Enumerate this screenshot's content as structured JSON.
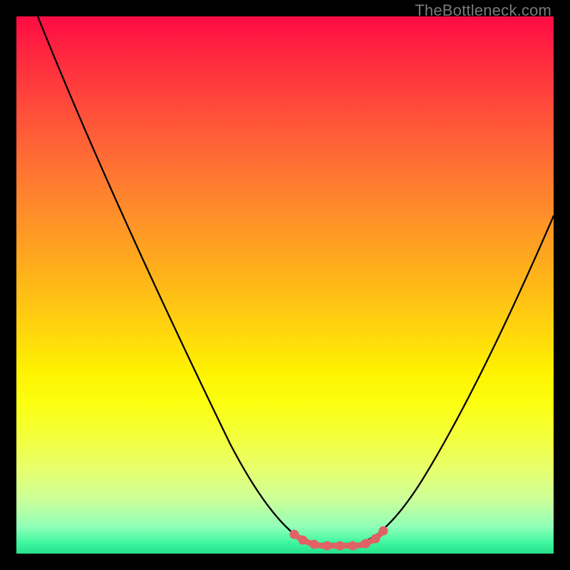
{
  "watermark": "TheBottleneck.com",
  "chart_data": {
    "type": "line",
    "title": "",
    "xlabel": "",
    "ylabel": "",
    "xlim": [
      0,
      100
    ],
    "ylim": [
      0,
      100
    ],
    "grid": false,
    "legend": false,
    "series": [
      {
        "name": "bottleneck-curve",
        "x": [
          4,
          10,
          18,
          26,
          34,
          40,
          45,
          48,
          51,
          54,
          57,
          60,
          63,
          67,
          72,
          78,
          85,
          92,
          100
        ],
        "y": [
          100,
          88,
          72,
          56,
          40,
          28,
          18,
          10,
          4,
          1,
          0.5,
          0.5,
          1,
          3,
          9,
          20,
          34,
          48,
          63
        ]
      }
    ],
    "highlight": {
      "name": "flat-minimum",
      "x": [
        51,
        53,
        55,
        57,
        59,
        61,
        63,
        65
      ],
      "y": [
        3.5,
        2.0,
        1.0,
        0.6,
        0.5,
        0.7,
        1.2,
        2.8
      ],
      "color": "#e06265"
    },
    "colors": {
      "curve": "#000000",
      "highlight": "#e06265",
      "background_top": "#ff0b44",
      "background_bottom": "#26e08a"
    }
  }
}
